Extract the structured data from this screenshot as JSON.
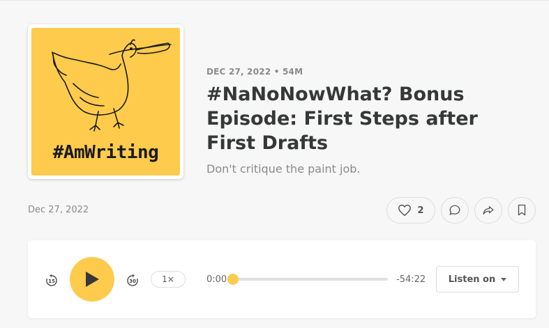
{
  "podcast": {
    "cover_text": "#AmWriting"
  },
  "episode": {
    "meta": "DEC 27, 2022 • 54M",
    "title": "#NaNoNowWhat? Bonus Episode: First Steps after First Drafts",
    "subtitle": "Don't critique the paint job.",
    "date": "Dec 27, 2022",
    "like_count": "2"
  },
  "actions": {
    "like_icon": "heart-icon",
    "comment_icon": "comment-icon",
    "share_icon": "share-icon",
    "bookmark_icon": "bookmark-icon"
  },
  "player": {
    "skip_back": "15",
    "skip_forward": "30",
    "speed": "1×",
    "current_time": "0:00",
    "remaining_time": "-54:22",
    "progress": 0,
    "listen_on_label": "Listen on"
  },
  "colors": {
    "accent": "#fecb4d",
    "text": "#363737",
    "muted": "#8a8a8a",
    "background": "#f7f7f7"
  }
}
